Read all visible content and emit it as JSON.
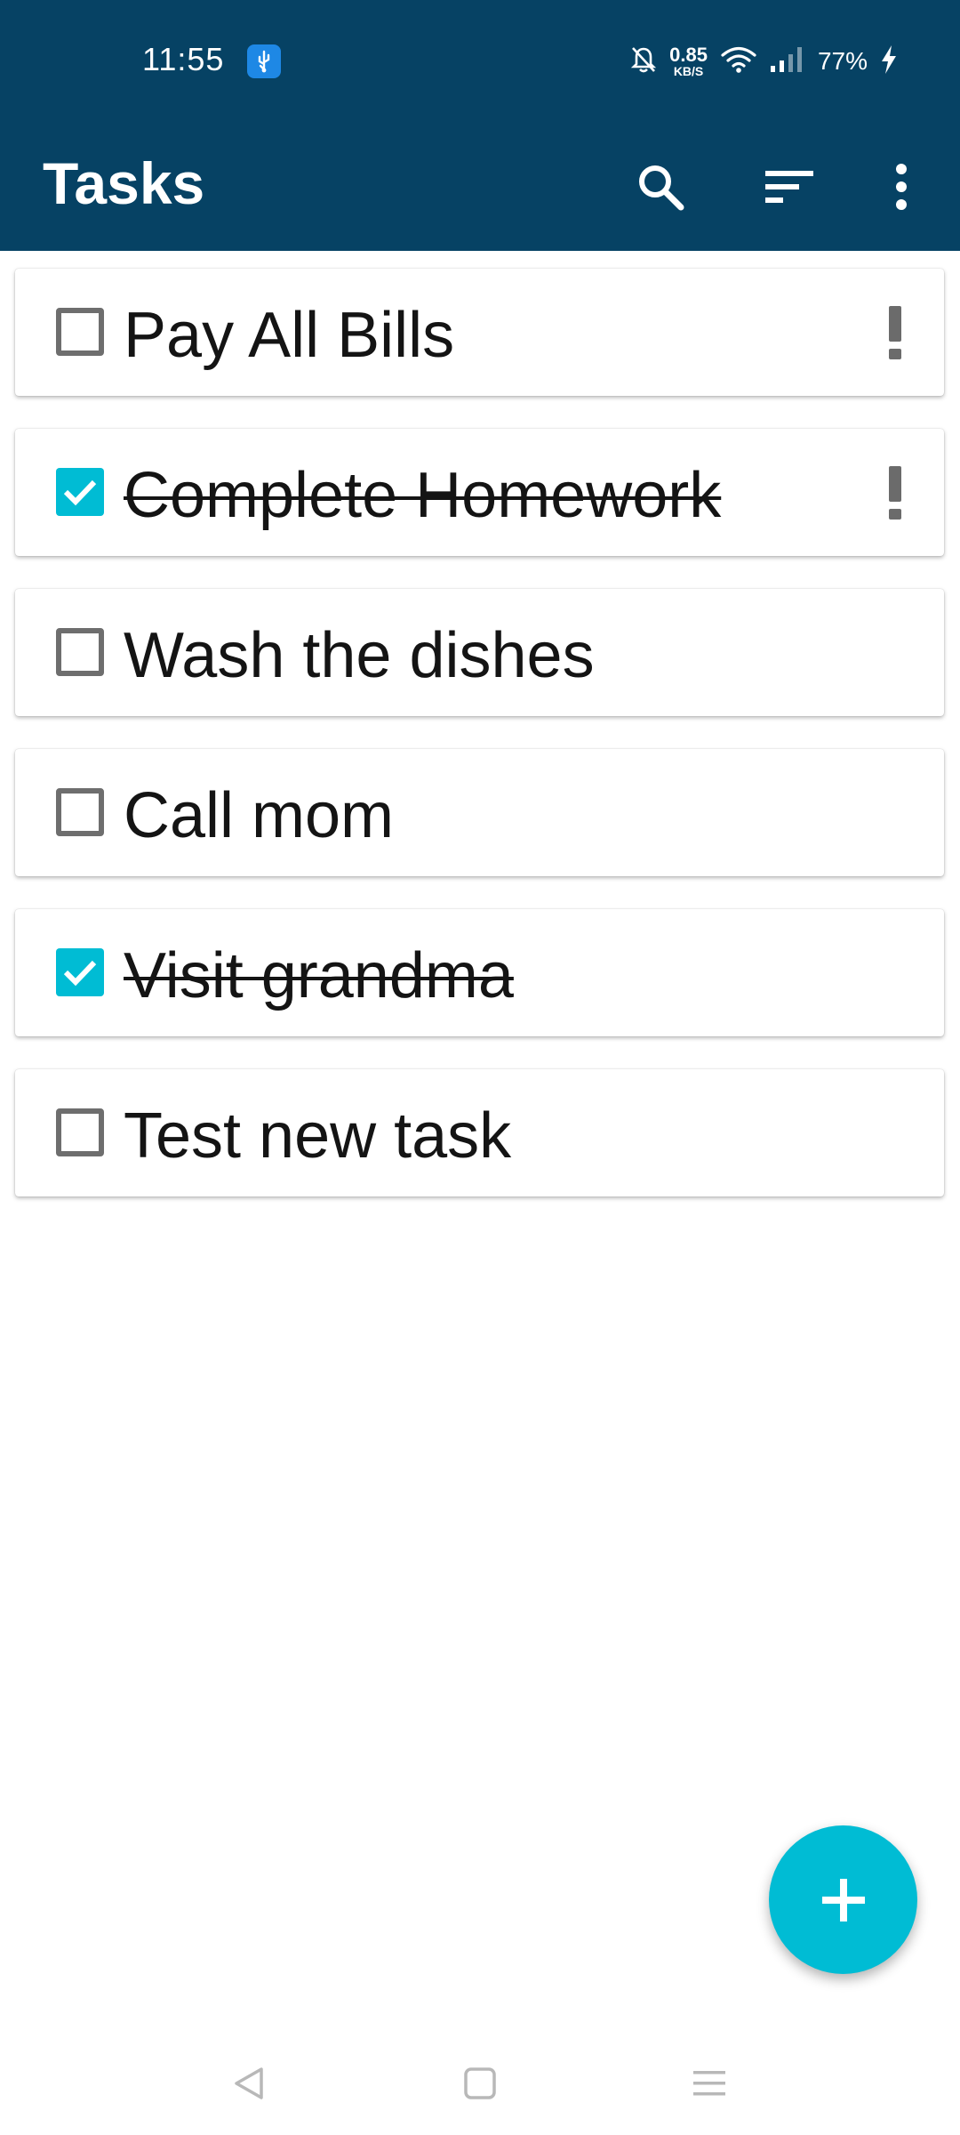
{
  "status_bar": {
    "time": "11:55",
    "net_speed_value": "0.85",
    "net_speed_unit": "KB/S",
    "battery": "77%",
    "icons": [
      "usb-icon",
      "bell-off-icon",
      "wifi-icon",
      "signal-icon",
      "charging-icon"
    ]
  },
  "app_bar": {
    "title": "Tasks",
    "actions": [
      "search-icon",
      "sort-icon",
      "more-vert-icon"
    ]
  },
  "tasks": [
    {
      "title": "Pay All Bills",
      "completed": false,
      "priority": true
    },
    {
      "title": "Complete Homework",
      "completed": true,
      "priority": true
    },
    {
      "title": "Wash the dishes",
      "completed": false,
      "priority": false
    },
    {
      "title": "Call mom",
      "completed": false,
      "priority": false
    },
    {
      "title": "Visit grandma",
      "completed": true,
      "priority": false
    },
    {
      "title": "Test new task",
      "completed": false,
      "priority": false
    }
  ],
  "fab": {
    "icon": "plus-icon"
  },
  "nav_bar": {
    "icons": [
      "back-icon",
      "home-icon",
      "recents-icon"
    ]
  },
  "colors": {
    "app_bar": "#064264",
    "accent": "#00bcd4",
    "checkbox_border": "#6e6e6e",
    "text": "#141414"
  }
}
